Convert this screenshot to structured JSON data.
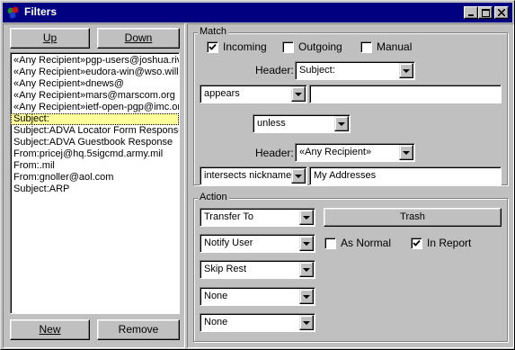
{
  "window": {
    "title": "Filters"
  },
  "left": {
    "up_label": "Up",
    "down_label": "Down",
    "new_label": "New",
    "remove_label": "Remove",
    "items": [
      "«Any Recipient»pgp-users@joshua.rive",
      "«Any Recipient»eudora-win@wso.willia",
      "«Any Recipient»dnews@",
      "«Any Recipient»mars@marscom.org",
      "«Any Recipient»ietf-open-pgp@imc.org",
      "Subject:",
      "Subject:ADVA Locator Form Response",
      "Subject:ADVA Guestbook Response",
      "From:pricej@hq.5sigcmd.army.mil",
      "From:.mil",
      "From:gnoller@aol.com",
      "Subject:ARP"
    ],
    "selected_index": 5
  },
  "match": {
    "legend": "Match",
    "incoming_label": "Incoming",
    "incoming_checked": true,
    "outgoing_label": "Outgoing",
    "outgoing_checked": false,
    "manual_label": "Manual",
    "manual_checked": false,
    "header1_label": "Header:",
    "header1_value": "Subject:",
    "verb1_value": "appears",
    "text1_value": "",
    "conjunction_value": "unless",
    "header2_label": "Header:",
    "header2_value": "«Any Recipient»",
    "verb2_value": "intersects nickname",
    "text2_value": "My Addresses"
  },
  "action": {
    "legend": "Action",
    "action1_value": "Transfer To",
    "trash_label": "Trash",
    "action2_value": "Notify User",
    "as_normal_label": "As Normal",
    "as_normal_checked": false,
    "in_report_label": "In Report",
    "in_report_checked": true,
    "action3_value": "Skip Rest",
    "action4_value": "None",
    "action5_value": "None"
  }
}
